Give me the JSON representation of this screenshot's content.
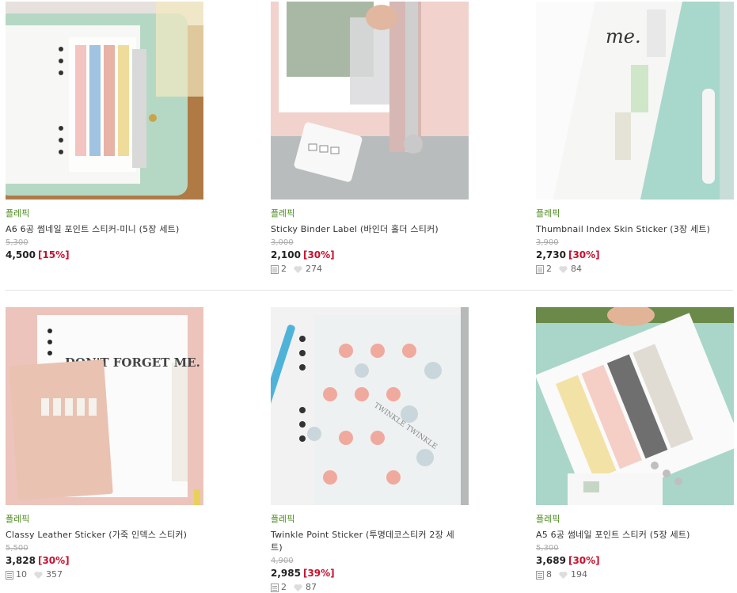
{
  "products": [
    {
      "brand": "플레픽",
      "title": "A6 6공 썸네일 포인트 스티커-미니 (5장 세트)",
      "original_price": "5,300",
      "price": "4,500",
      "discount": "[15%]",
      "reviews": "",
      "likes": ""
    },
    {
      "brand": "플레픽",
      "title": "Sticky Binder Label (바인더 홀더 스티커)",
      "original_price": "3,000",
      "price": "2,100",
      "discount": "[30%]",
      "reviews": "2",
      "likes": "274"
    },
    {
      "brand": "플레픽",
      "title": "Thumbnail Index Skin Sticker (3장 세트)",
      "original_price": "3,900",
      "price": "2,730",
      "discount": "[30%]",
      "reviews": "2",
      "likes": "84"
    },
    {
      "brand": "플레픽",
      "title": "Classy Leather Sticker (가죽 인덱스 스티커)",
      "original_price": "5,500",
      "price": "3,828",
      "discount": "[30%]",
      "reviews": "10",
      "likes": "357"
    },
    {
      "brand": "플레픽",
      "title": "Twinkle Point Sticker (투명데코스티커 2장 세트)",
      "original_price": "4,900",
      "price": "2,985",
      "discount": "[39%]",
      "reviews": "2",
      "likes": "87"
    },
    {
      "brand": "플레픽",
      "title": "A5 6공 썸네일 포인트 스티커 (5장 세트)",
      "original_price": "5,300",
      "price": "3,689",
      "discount": "[30%]",
      "reviews": "8",
      "likes": "194"
    }
  ],
  "image_text": {
    "note_me": "me.",
    "dont_forget": "DON'T FORGET ME.",
    "twinkle": "TWINKLE TWINKLE"
  },
  "colors": {
    "brand": "#4a8a1a",
    "discount": "#c8102e",
    "mint": "#a9d6c9",
    "pink": "#ecc4bb"
  }
}
